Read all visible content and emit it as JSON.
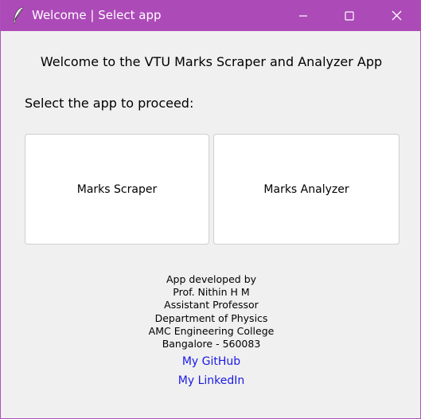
{
  "window": {
    "title": "Welcome | Select app",
    "titlebar_color": "#ac4ab8",
    "app_icon": "feather-icon",
    "controls": [
      "minimize-icon",
      "maximize-icon",
      "close-icon"
    ]
  },
  "main": {
    "welcome_text": "Welcome to the VTU Marks Scraper and Analyzer App",
    "select_prompt": "Select the app to proceed:",
    "buttons": [
      {
        "label": "Marks Scraper"
      },
      {
        "label": "Marks Analyzer"
      }
    ]
  },
  "credits": {
    "lines": [
      "App developed by",
      "Prof. Nithin H M",
      "Assistant Professor",
      "Department of Physics",
      "AMC Engineering College",
      "Bangalore - 560083"
    ],
    "github_link": "My GitHub",
    "linkedin_link": "My LinkedIn",
    "link_color": "#1a1ae6"
  }
}
